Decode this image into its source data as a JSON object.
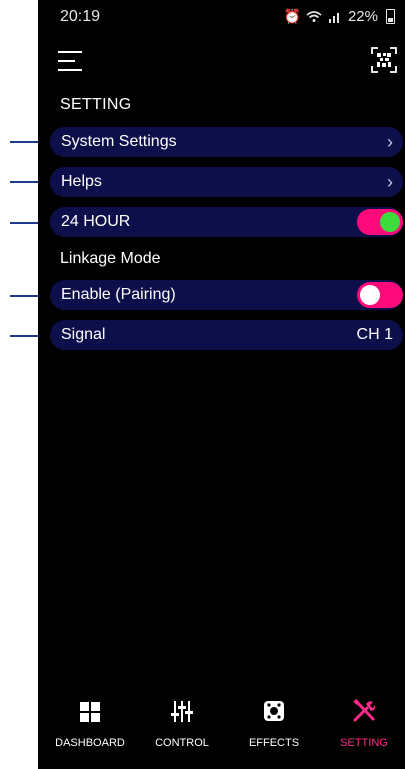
{
  "status_bar": {
    "time": "20:19",
    "battery": "22%"
  },
  "page": {
    "section_title": "SETTING",
    "linkage_title": "Linkage Mode"
  },
  "settings": {
    "system_settings": "System Settings",
    "helps": "Helps",
    "hour24": "24 HOUR",
    "hour24_on": true,
    "enable_pairing": "Enable (Pairing)",
    "enable_pairing_on": false,
    "signal": "Signal",
    "signal_value": "CH 1"
  },
  "nav": {
    "items": [
      {
        "label": "DASHBOARD",
        "icon": "grid-icon",
        "active": false
      },
      {
        "label": "CONTROL",
        "icon": "sliders-icon",
        "active": false
      },
      {
        "label": "EFFECTS",
        "icon": "effects-icon",
        "active": false
      },
      {
        "label": "SETTING",
        "icon": "tools-icon",
        "active": true
      }
    ]
  },
  "colors": {
    "background": "#000000",
    "row_bg": "#0c0f4a",
    "accent_pink": "#ff0a7a",
    "toggle_on_knob": "#3ddc3d",
    "active_nav": "#ff2a8a"
  }
}
